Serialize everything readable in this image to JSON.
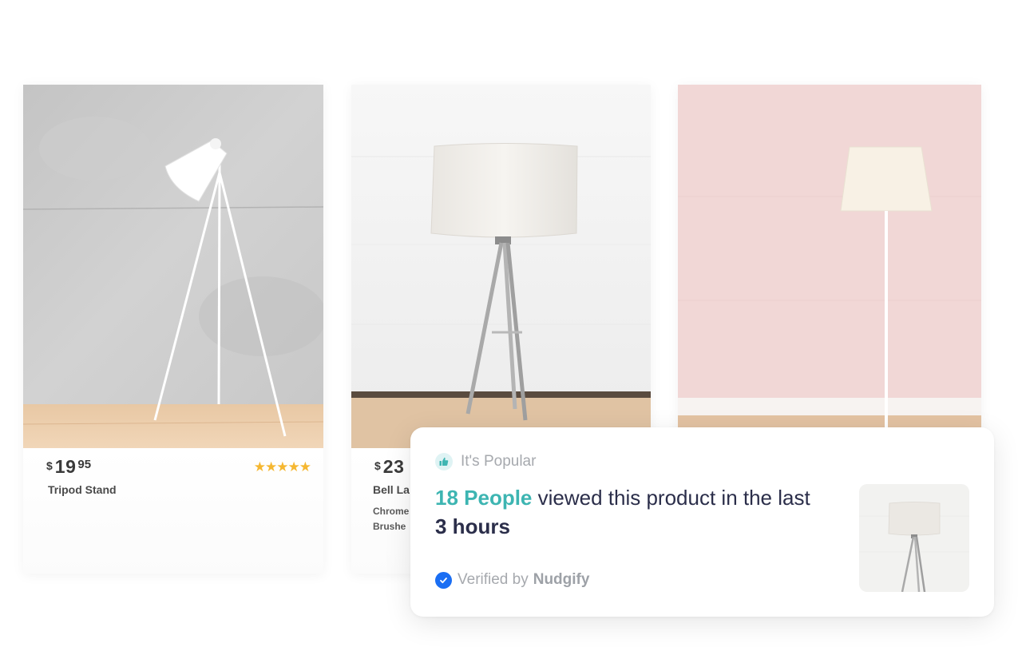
{
  "products": [
    {
      "currency": "$",
      "price_int": "19",
      "price_cents": "95",
      "name": "Tripod Stand",
      "rating_stars": 5,
      "stars": "★★★★★"
    },
    {
      "currency": "$",
      "price_int": "23",
      "name": "Bell La",
      "desc_line1": "Chrome",
      "desc_line2": "Brushe"
    }
  ],
  "popup": {
    "label": "It's Popular",
    "message_highlight": "18 People",
    "message_mid": " viewed this product in the last ",
    "message_bold": "3 hours",
    "verified_prefix": "Verified by",
    "verified_brand": "Nudgify"
  },
  "colors": {
    "accent_teal": "#3db5b2",
    "text_dark": "#2b2e4a",
    "verify_blue": "#1a6ef3",
    "star_gold": "#f5b731"
  }
}
